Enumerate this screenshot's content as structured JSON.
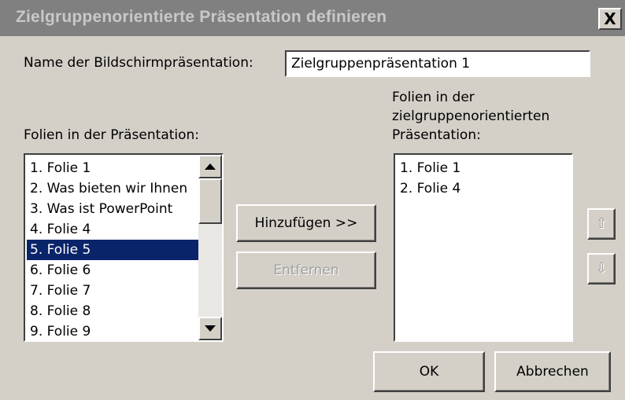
{
  "window": {
    "title": "Zielgruppenorientierte Präsentation definieren",
    "close_label": "X"
  },
  "name_field": {
    "label": "Name der Bildschirmpräsentation:",
    "value": "Zielgruppenpräsentation 1"
  },
  "source_list": {
    "label": "Folien in der Präsentation:",
    "items": [
      "1. Folie 1",
      "2. Was bieten wir Ihnen",
      "3. Was ist PowerPoint",
      "4. Folie 4",
      "5. Folie 5",
      "6. Folie 6",
      "7. Folie 7",
      "8. Folie 8",
      "9. Folie 9"
    ],
    "selected_index": 4
  },
  "target_list": {
    "label": "Folien in der zielgruppenorientierten Präsentation:",
    "items": [
      "1. Folie 1",
      "2. Folie 4"
    ]
  },
  "buttons": {
    "add": "Hinzufügen >>",
    "remove": "Entfernen",
    "ok": "OK",
    "cancel": "Abbrechen",
    "move_up_glyph": "⇧",
    "move_down_glyph": "⇩"
  },
  "icons": {
    "close": "close-icon",
    "scroll_up": "chevron-up-icon",
    "scroll_down": "chevron-down-icon",
    "move_up": "arrow-up-icon",
    "move_down": "arrow-down-icon"
  },
  "colors": {
    "selection": "#0a246a",
    "titlebar": "#808080",
    "face": "#d4d0c8"
  }
}
